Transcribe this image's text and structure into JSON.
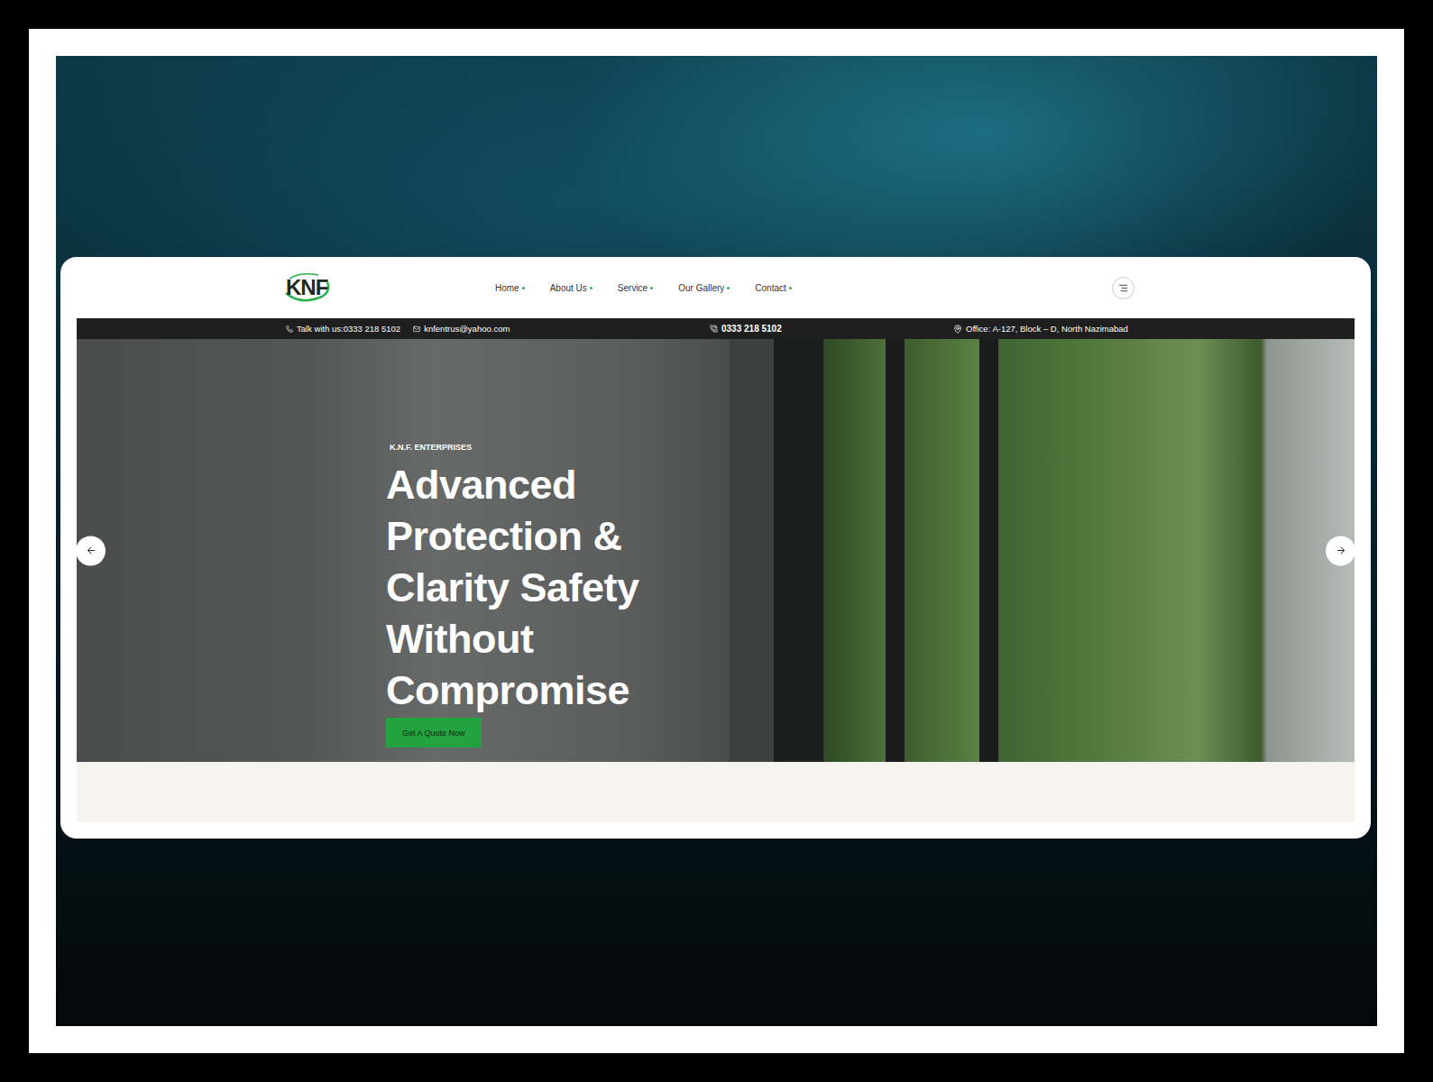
{
  "header": {
    "logo": "KNF",
    "nav": [
      {
        "label": "Home"
      },
      {
        "label": "About Us"
      },
      {
        "label": "Service"
      },
      {
        "label": "Our Gallery"
      },
      {
        "label": "Contact"
      }
    ]
  },
  "topbar": {
    "talk": "Talk with us:0333 218 5102",
    "email": "knfentrus@yahoo.com",
    "phone": "0333 218 5102",
    "office": "Office: A-127, Block – D, North Nazimabad"
  },
  "hero": {
    "eyebrow": "K.N.F. ENTERPRISES",
    "title_lines": [
      "Advanced",
      "Protection &",
      "Clarity Safety",
      "Without",
      "Compromise"
    ],
    "button": "Get A Quote Now"
  }
}
